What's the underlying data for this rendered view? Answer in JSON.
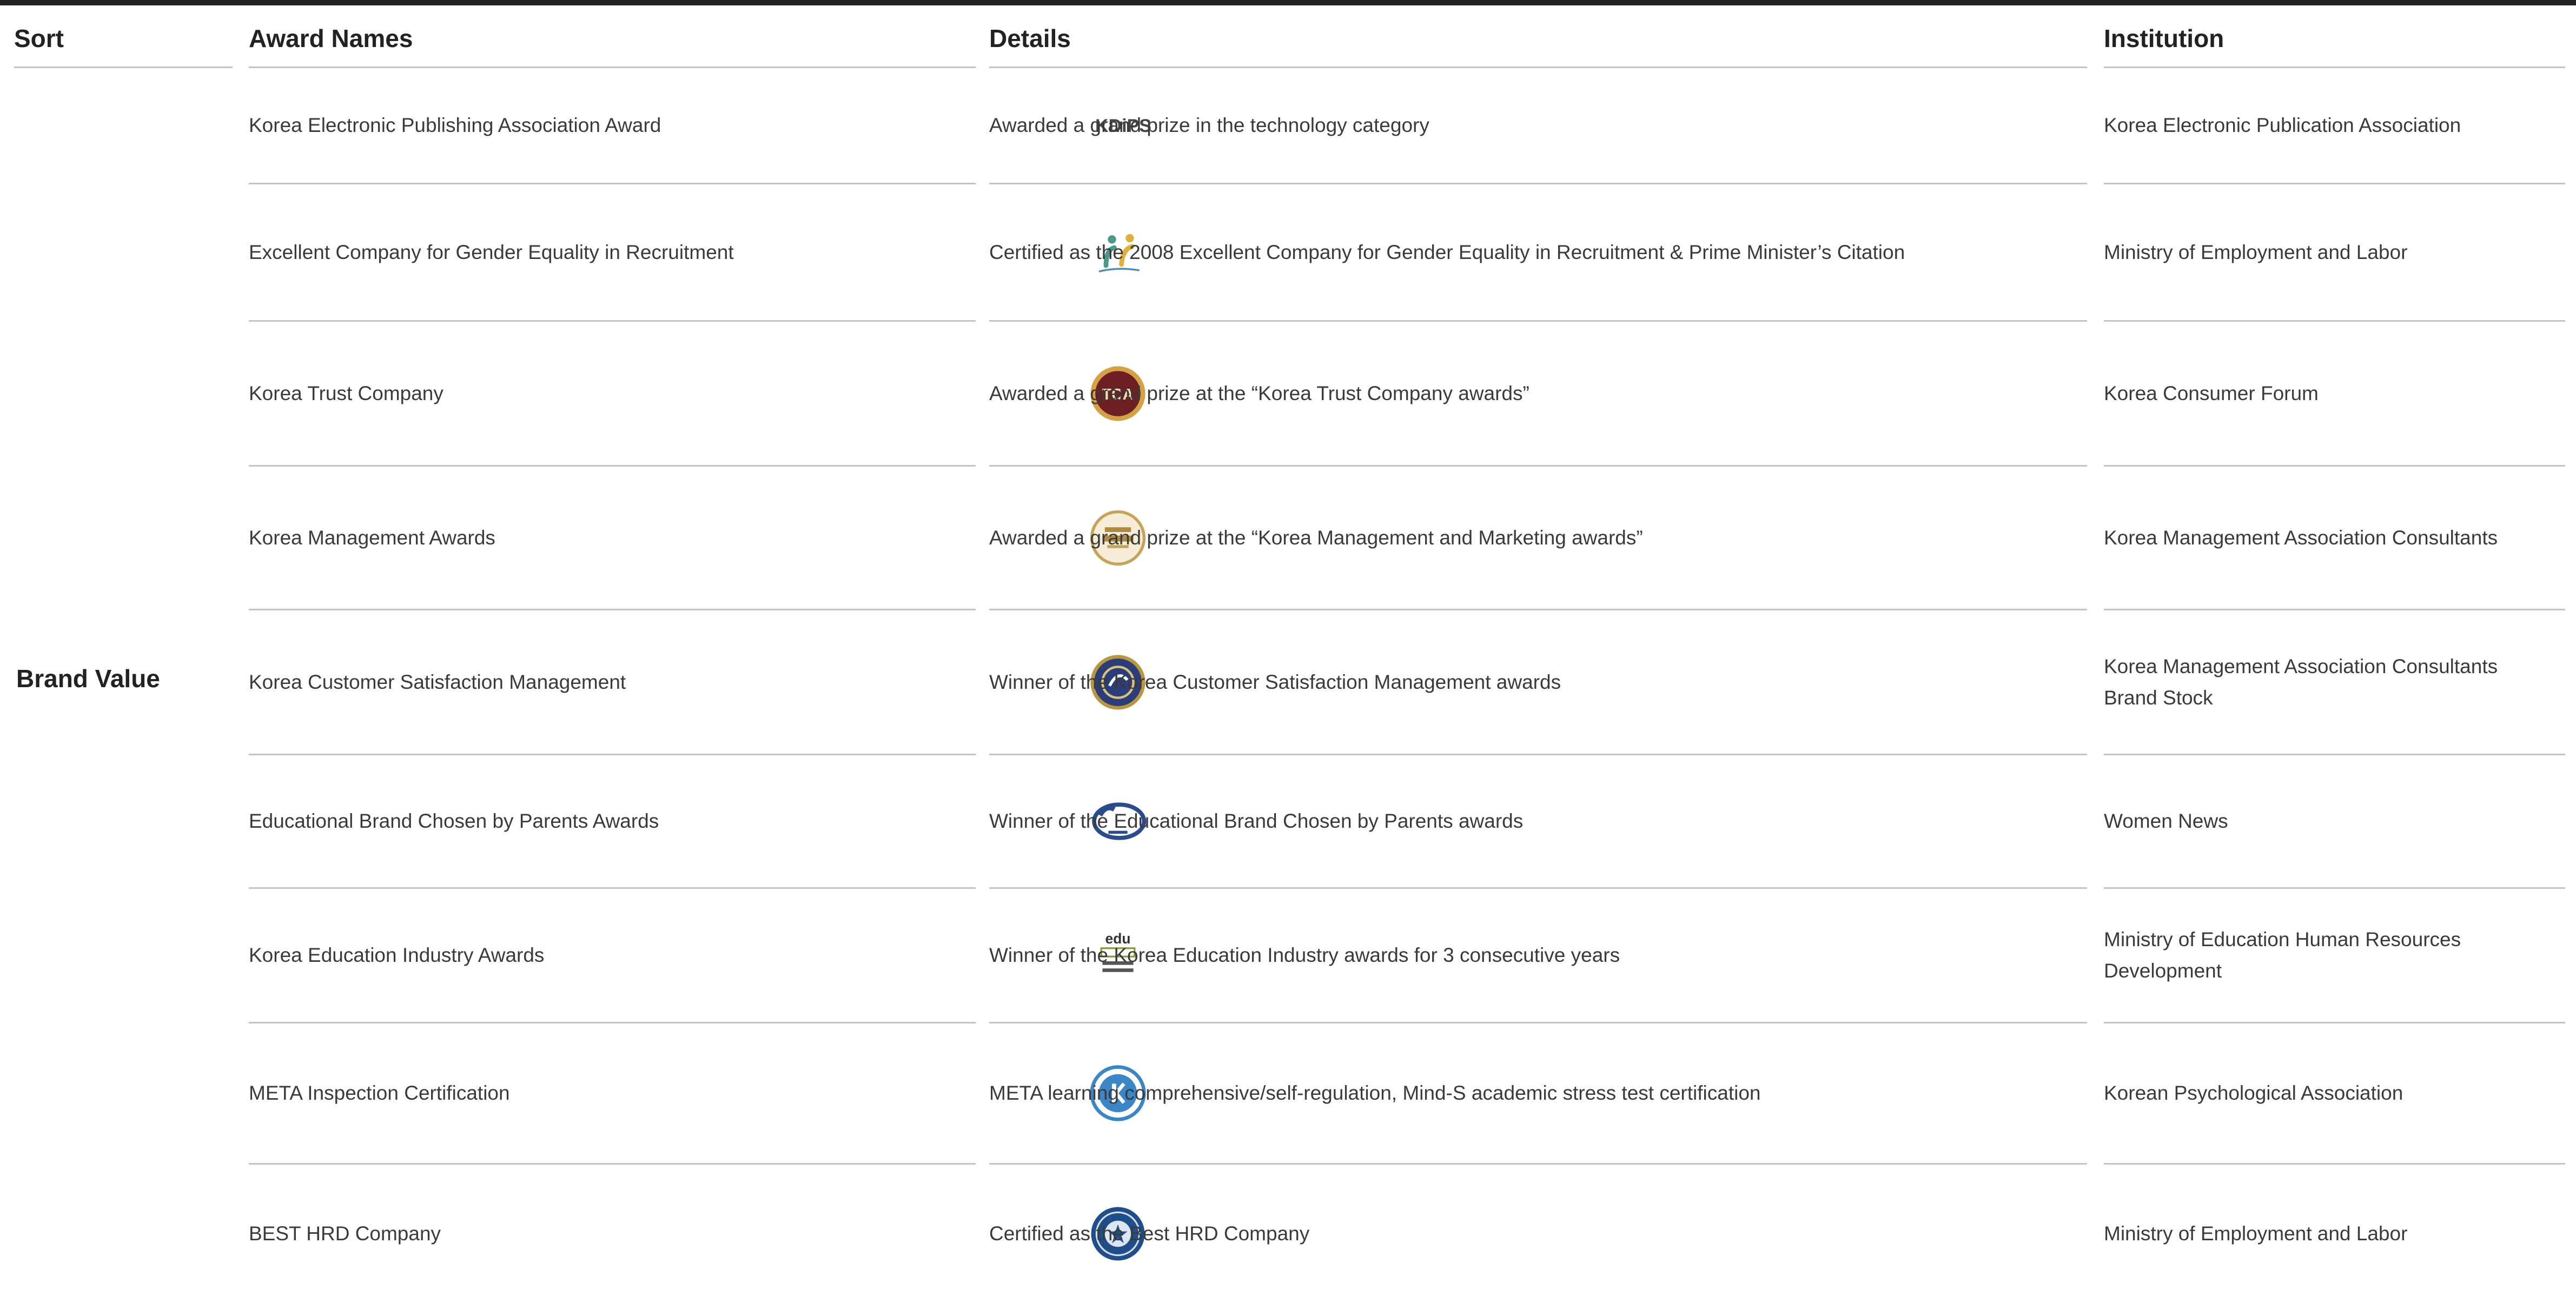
{
  "headers": {
    "sort": "Sort",
    "award": "Award Names",
    "details": "Details",
    "institution": "Institution"
  },
  "sort_group": "Brand Value",
  "colors": {
    "text": "#3a3a3a",
    "heading": "#222222",
    "rule": "#c4c4c4",
    "top_bar": "#222222"
  },
  "rows": [
    {
      "award": "Korea Electronic Publishing Association Award",
      "logo": "kdips-logo",
      "logo_text": "KDiPS",
      "details": "Awarded a grand prize in the technology category",
      "institution": [
        "Korea Electronic Publication Association"
      ]
    },
    {
      "award": "Excellent Company for Gender Equality in Recruitment",
      "logo": "gender-equality-logo",
      "details": "Certified as the 2008 Excellent Company for Gender Equality in Recruitment & Prime Minister’s Citation",
      "institution": [
        "Ministry of Employment and Labor"
      ]
    },
    {
      "award": "Korea Trust Company",
      "logo": "tca-seal-logo",
      "logo_text": "TCA",
      "details": "Awarded a grand prize  at the “Korea Trust Company awards”",
      "institution": [
        "Korea Consumer Forum"
      ]
    },
    {
      "award": "Korea Management Awards",
      "logo": "management-awards-seal-logo",
      "details": "Awarded a grand prize  at the “Korea Management and Marketing awards”",
      "institution": [
        "Korea Management Association Consultants"
      ]
    },
    {
      "award": "Korea Customer Satisfaction Management",
      "logo": "customer-satisfaction-seal-logo",
      "details": "Winner of the Korea Customer Satisfaction Management awards",
      "institution": [
        "Korea Management Association Consultants",
        "Brand Stock"
      ]
    },
    {
      "award": "Educational Brand Chosen by Parents Awards",
      "logo": "parents-brand-logo",
      "details": "Winner of the Educational Brand Chosen by Parents awards",
      "institution": [
        "Women News"
      ]
    },
    {
      "award": "Korea Education Industry Awards",
      "logo": "edu-2006-logo",
      "logo_text": "edu",
      "details": "Winner of the Korea Education Industry awards for 3 consecutive years",
      "institution": [
        "Ministry of Education Human Resources Development"
      ]
    },
    {
      "award": "META Inspection Certification",
      "logo": "meta-certification-logo",
      "details": "META learning comprehensive/self-regulation, Mind-S academic stress test certification",
      "institution": [
        "Korean Psychological Association"
      ]
    },
    {
      "award": "BEST HRD Company",
      "logo": "best-hrd-seal-logo",
      "details": "Certified as the Best HRD Company",
      "institution": [
        "Ministry of Employment and Labor"
      ]
    }
  ]
}
